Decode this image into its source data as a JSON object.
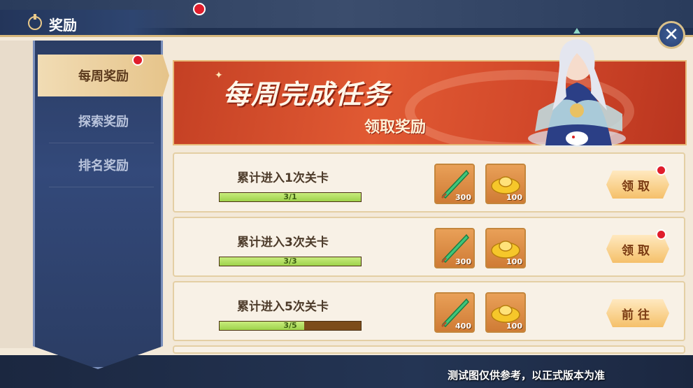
{
  "header": {
    "title": "奖励"
  },
  "tabs": [
    {
      "label": "每周奖励",
      "active": true,
      "has_notification": true
    },
    {
      "label": "探索奖励",
      "active": false
    },
    {
      "label": "排名奖励",
      "active": false
    }
  ],
  "banner": {
    "title": "每周完成任务",
    "subtitle": "领取奖励"
  },
  "tasks": [
    {
      "title": "累计进入1次关卡",
      "progress_text": "3/1",
      "progress_fraction": 1.0,
      "rewards": [
        {
          "icon": "jade-dagger-icon",
          "qty": "300"
        },
        {
          "icon": "gold-ingot-icon",
          "qty": "100"
        }
      ],
      "button": "领取",
      "button_notification": true
    },
    {
      "title": "累计进入3次关卡",
      "progress_text": "3/3",
      "progress_fraction": 1.0,
      "rewards": [
        {
          "icon": "jade-dagger-icon",
          "qty": "300"
        },
        {
          "icon": "gold-ingot-icon",
          "qty": "100"
        }
      ],
      "button": "领取",
      "button_notification": true
    },
    {
      "title": "累计进入5次关卡",
      "progress_text": "3/5",
      "progress_fraction": 0.6,
      "rewards": [
        {
          "icon": "jade-dagger-icon",
          "qty": "400"
        },
        {
          "icon": "gold-ingot-icon",
          "qty": "100"
        }
      ],
      "button": "前往",
      "button_notification": false
    }
  ],
  "footer": {
    "note": "测试图仅供参考，以正式版本为准"
  },
  "colors": {
    "accent_gold": "#e6c48a",
    "progress_green": "#9ed34b",
    "notification_red": "#e01d2c"
  }
}
